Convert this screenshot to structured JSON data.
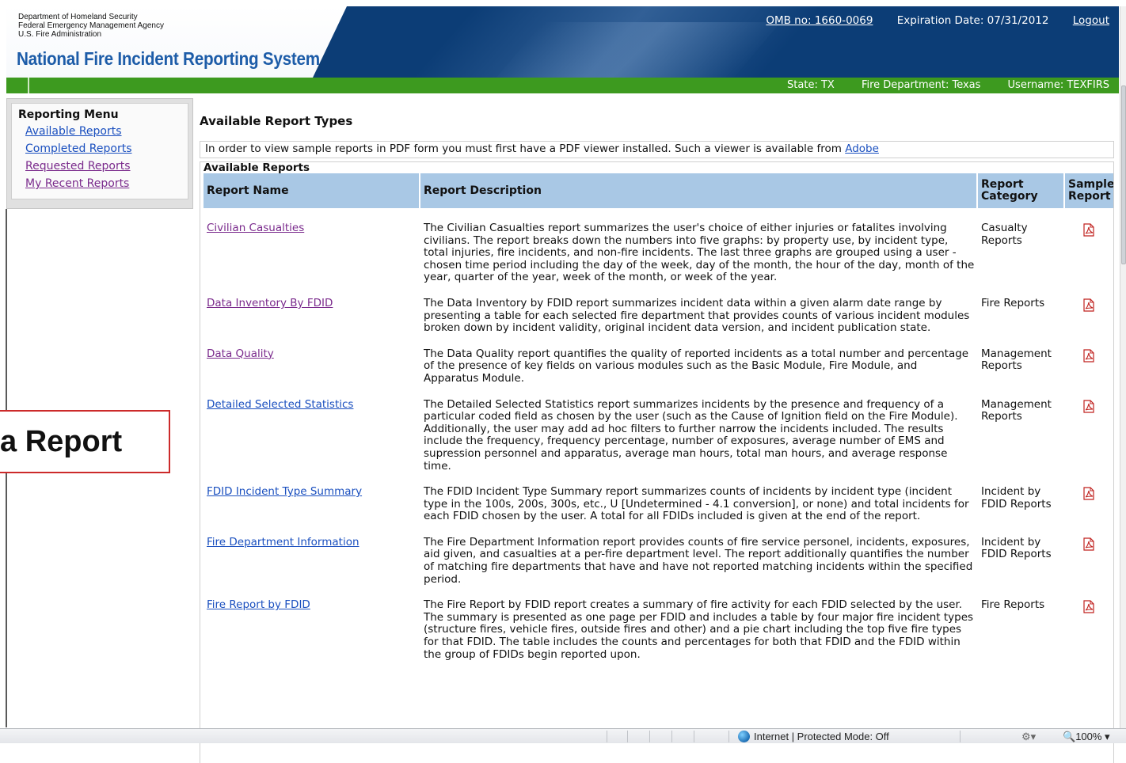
{
  "header": {
    "agency_lines": [
      "Department of Homeland Security",
      "Federal Emergency Management Agency",
      "U.S. Fire Administration"
    ],
    "app_title": "National Fire Incident Reporting System",
    "omb": "OMB no: 1660-0069",
    "expiration": "Expiration Date: 07/31/2012",
    "logout": "Logout"
  },
  "infobar": {
    "state": "State: TX",
    "fire_department": "Fire Department: Texas",
    "username": "Username: TEXFIRS"
  },
  "sidebar": {
    "title": "Reporting Menu",
    "items": [
      {
        "label": "Available Reports"
      },
      {
        "label": "Completed Reports"
      },
      {
        "label": "Requested Reports"
      },
      {
        "label": "My Recent Reports"
      }
    ]
  },
  "main": {
    "heading": "Available Report Types",
    "pdf_note": "In order to view sample reports in PDF form you must first have a PDF viewer installed. Such a viewer is available from",
    "pdf_link": "Adobe",
    "section_title": "Available Reports",
    "columns": [
      "Report Name",
      "Report Description",
      "Report Category",
      "Sample Report"
    ],
    "rows": [
      {
        "name": "Civilian Casualties",
        "description": "The Civilian Casualties report summarizes the user's choice of either injuries or fatalites involving civilians. The report breaks down the numbers into five graphs: by property use, by incident type, total injuries, fire incidents, and non-fire incidents. The last three graphs are grouped using a user -chosen time period including the day of the week, day of the month, the hour of the day, month of the year, quarter of the year, week of the month, or week of the year.",
        "category": "Casualty Reports"
      },
      {
        "name": "Data Inventory By FDID",
        "description": "The Data Inventory by FDID report summarizes incident data within a given alarm date range by presenting a table for each selected fire department that provides counts of various incident modules broken down by incident validity, original incident data version, and incident publication state.",
        "category": "Fire Reports"
      },
      {
        "name": "Data Quality",
        "description": "The Data Quality report quantifies the quality of reported incidents as a total number and percentage of the presence of key fields on various modules such as the Basic Module, Fire Module, and Apparatus Module.",
        "category": "Management Reports"
      },
      {
        "name": "Detailed Selected Statistics",
        "description": "The Detailed Selected Statistics report summarizes incidents by the presence and frequency of a particular coded field as chosen by the user (such as the Cause of Ignition field on the Fire Module). Additionally, the user may add ad hoc filters to further narrow the incidents included. The results include the frequency, frequency percentage, number of exposures, average number of EMS and supression personnel and apparatus, average man hours, total man hours, and average response time.",
        "category": "Management Reports"
      },
      {
        "name": "FDID Incident Type Summary",
        "description": "The FDID Incident Type Summary report summarizes counts of incidents by incident type (incident type in the 100s, 200s, 300s, etc., U [Undetermined - 4.1 conversion], or none) and total incidents for each FDID chosen by the user. A total for all FDIDs included is given at the end of the report.",
        "category": "Incident by FDID Reports"
      },
      {
        "name": "Fire Department Information",
        "description": "The Fire Department Information report provides counts of fire service personel, incidents, exposures, aid given, and casualties at a per-fire department level. The report additionally quantifies the number of matching fire departments that have and have not reported matching incidents within the specified period.",
        "category": "Incident by FDID Reports"
      },
      {
        "name": "Fire Report by FDID",
        "description": "The Fire Report by FDID report creates a summary of fire activity for each FDID selected by the user. The summary is presented as one page per FDID and includes a table by four major fire incident types (structure fires, vehicle fires, outside fires and other) and a pie chart including the top five fire types for that FDID. The table includes the counts and percentages for both that FDID and the FDID within the group of FDIDs begin reported upon.",
        "category": "Fire Reports"
      }
    ]
  },
  "callout": {
    "text": "a Report"
  },
  "statusbar": {
    "zone": "Internet | Protected Mode: Off",
    "zoom": "100%"
  },
  "icons": {
    "sample_report": "pdf-icon",
    "zone": "globe-icon",
    "zoom": "magnifier-icon"
  }
}
